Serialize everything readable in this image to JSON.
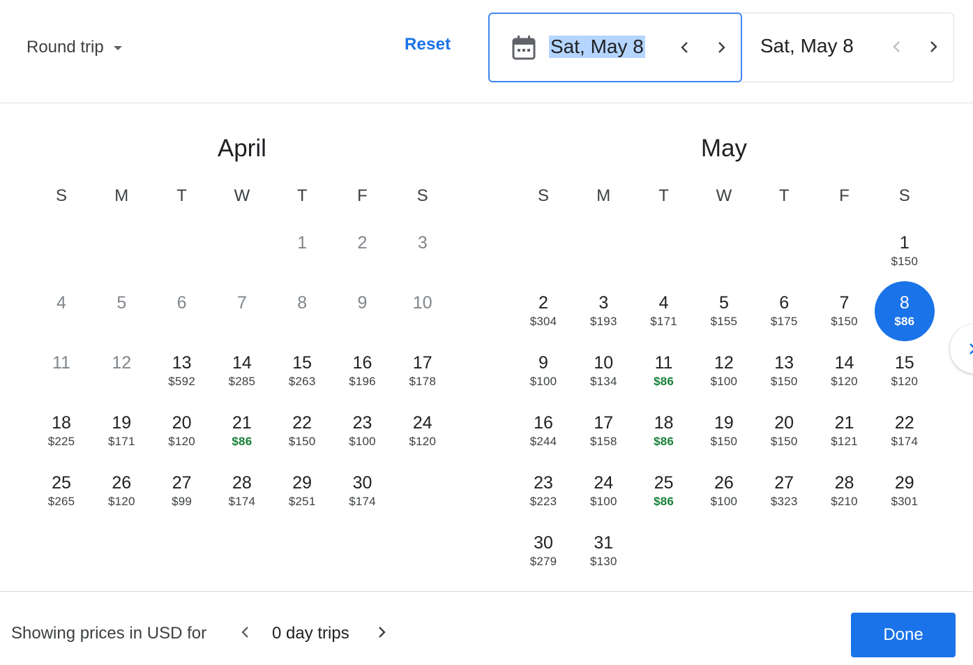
{
  "header": {
    "trip_type": "Round trip",
    "reset_label": "Reset",
    "depart_date": "Sat, May 8",
    "return_date": "Sat, May 8"
  },
  "weekdays": [
    "S",
    "M",
    "T",
    "W",
    "T",
    "F",
    "S"
  ],
  "months": [
    {
      "name": "April",
      "first_weekday": 4,
      "days": [
        {
          "d": "1",
          "p": "",
          "past": true
        },
        {
          "d": "2",
          "p": "",
          "past": true
        },
        {
          "d": "3",
          "p": "",
          "past": true
        },
        {
          "d": "4",
          "p": "",
          "past": true
        },
        {
          "d": "5",
          "p": "",
          "past": true
        },
        {
          "d": "6",
          "p": "",
          "past": true
        },
        {
          "d": "7",
          "p": "",
          "past": true
        },
        {
          "d": "8",
          "p": "",
          "past": true
        },
        {
          "d": "9",
          "p": "",
          "past": true
        },
        {
          "d": "10",
          "p": "",
          "past": true
        },
        {
          "d": "11",
          "p": "",
          "past": true
        },
        {
          "d": "12",
          "p": "",
          "past": true
        },
        {
          "d": "13",
          "p": "$592"
        },
        {
          "d": "14",
          "p": "$285"
        },
        {
          "d": "15",
          "p": "$263"
        },
        {
          "d": "16",
          "p": "$196"
        },
        {
          "d": "17",
          "p": "$178"
        },
        {
          "d": "18",
          "p": "$225"
        },
        {
          "d": "19",
          "p": "$171"
        },
        {
          "d": "20",
          "p": "$120"
        },
        {
          "d": "21",
          "p": "$86",
          "cheap": true
        },
        {
          "d": "22",
          "p": "$150"
        },
        {
          "d": "23",
          "p": "$100"
        },
        {
          "d": "24",
          "p": "$120"
        },
        {
          "d": "25",
          "p": "$265"
        },
        {
          "d": "26",
          "p": "$120"
        },
        {
          "d": "27",
          "p": "$99"
        },
        {
          "d": "28",
          "p": "$174"
        },
        {
          "d": "29",
          "p": "$251"
        },
        {
          "d": "30",
          "p": "$174"
        }
      ]
    },
    {
      "name": "May",
      "first_weekday": 6,
      "days": [
        {
          "d": "1",
          "p": "$150"
        },
        {
          "d": "2",
          "p": "$304"
        },
        {
          "d": "3",
          "p": "$193"
        },
        {
          "d": "4",
          "p": "$171"
        },
        {
          "d": "5",
          "p": "$155"
        },
        {
          "d": "6",
          "p": "$175"
        },
        {
          "d": "7",
          "p": "$150"
        },
        {
          "d": "8",
          "p": "$86",
          "selected": true
        },
        {
          "d": "9",
          "p": "$100"
        },
        {
          "d": "10",
          "p": "$134"
        },
        {
          "d": "11",
          "p": "$86",
          "cheap": true
        },
        {
          "d": "12",
          "p": "$100"
        },
        {
          "d": "13",
          "p": "$150"
        },
        {
          "d": "14",
          "p": "$120"
        },
        {
          "d": "15",
          "p": "$120"
        },
        {
          "d": "16",
          "p": "$244"
        },
        {
          "d": "17",
          "p": "$158"
        },
        {
          "d": "18",
          "p": "$86",
          "cheap": true
        },
        {
          "d": "19",
          "p": "$150"
        },
        {
          "d": "20",
          "p": "$150"
        },
        {
          "d": "21",
          "p": "$121"
        },
        {
          "d": "22",
          "p": "$174"
        },
        {
          "d": "23",
          "p": "$223"
        },
        {
          "d": "24",
          "p": "$100"
        },
        {
          "d": "25",
          "p": "$86",
          "cheap": true
        },
        {
          "d": "26",
          "p": "$100"
        },
        {
          "d": "27",
          "p": "$323"
        },
        {
          "d": "28",
          "p": "$210"
        },
        {
          "d": "29",
          "p": "$301"
        },
        {
          "d": "30",
          "p": "$279"
        },
        {
          "d": "31",
          "p": "$130"
        }
      ]
    }
  ],
  "footer": {
    "showing_text": "Showing prices in USD for",
    "trip_length": "0 day trips",
    "done_label": "Done"
  },
  "icons": {
    "calendar": "calendar-icon",
    "chevron_left": "chevron-left-icon",
    "chevron_right": "chevron-right-icon",
    "dropdown": "arrow-drop-down-icon"
  },
  "colors": {
    "accent": "#1a73e8",
    "cheap_price": "#188038",
    "selection_highlight": "#b4d5fe"
  }
}
